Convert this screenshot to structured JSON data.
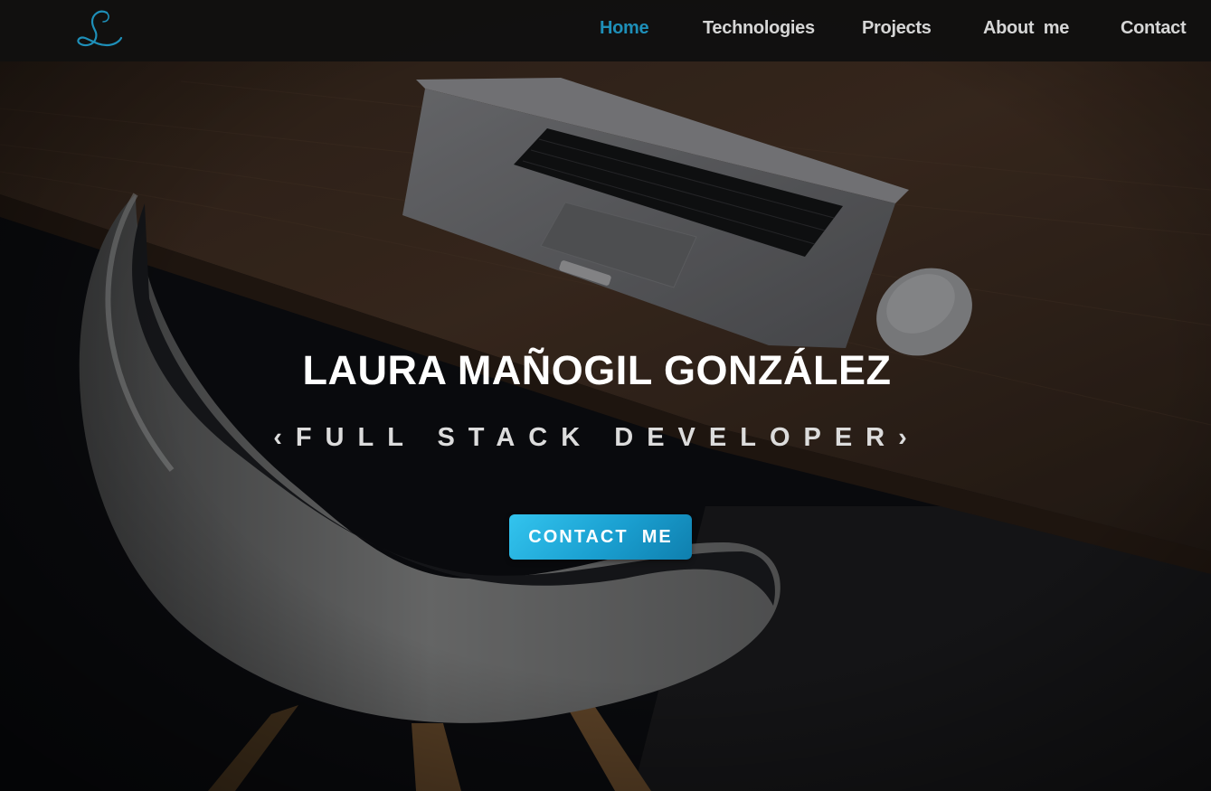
{
  "nav": {
    "logo_icon": "script-letter-L-logo",
    "items": [
      {
        "label": "Home",
        "active": true
      },
      {
        "label": "Technologies",
        "active": false
      },
      {
        "label": "Projects",
        "active": false
      },
      {
        "label": "About  me",
        "active": false
      },
      {
        "label": "Contact",
        "active": false
      }
    ]
  },
  "hero": {
    "title": "LAURA MAÑOGIL GONZÁLEZ",
    "subtitle": "‹FULL STACK DEVELOPER›",
    "cta_label": "CONTACT  ME"
  },
  "colors": {
    "accent": "#1e8fb8",
    "nav_text": "#d6d6d6",
    "navbar_bg": "#121110",
    "cta_start": "#33c4ee",
    "cta_end": "#0f7fae"
  }
}
